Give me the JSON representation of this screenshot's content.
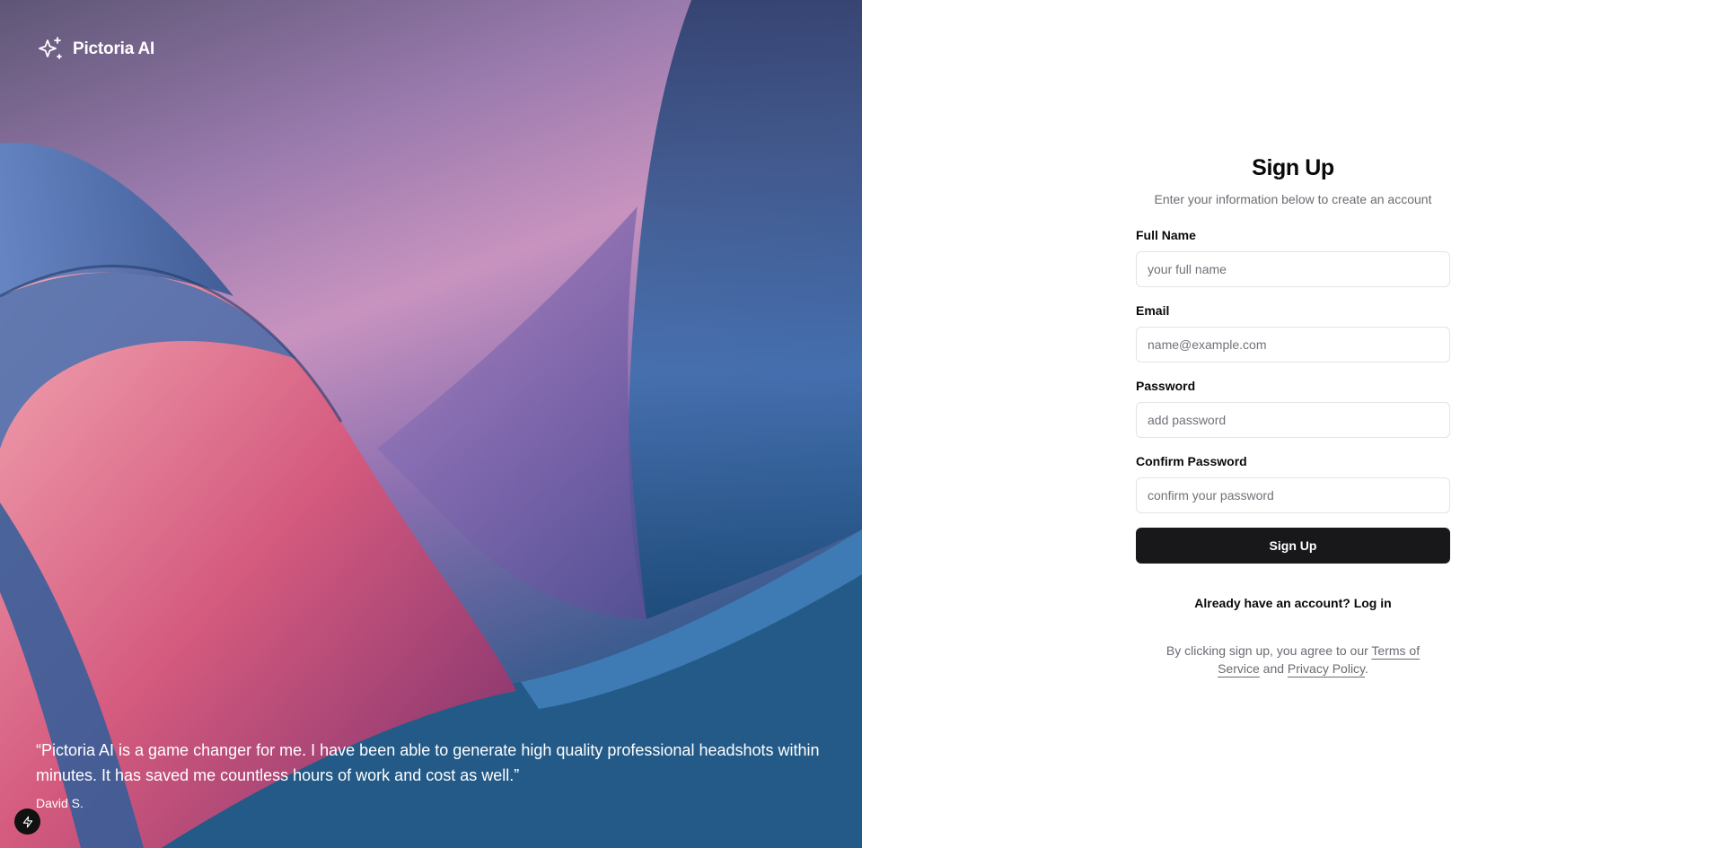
{
  "brand": {
    "name": "Pictoria AI",
    "icon": "sparkles-icon"
  },
  "hero": {
    "quote": "“Pictoria AI is a game changer for me. I have been able to generate high quality professional headshots within minutes. It has saved me countless hours of work and cost as well.”",
    "author": "David S.",
    "badge_icon": "bolt-icon"
  },
  "form": {
    "title": "Sign Up",
    "subtitle": "Enter your information below to create an account",
    "fields": [
      {
        "label": "Full Name",
        "placeholder": "your full name",
        "value": ""
      },
      {
        "label": "Email",
        "placeholder": "name@example.com",
        "value": ""
      },
      {
        "label": "Password",
        "placeholder": "add password",
        "value": ""
      },
      {
        "label": "Confirm Password",
        "placeholder": "confirm your password",
        "value": ""
      }
    ],
    "submit_label": "Sign Up",
    "login_prompt": "Already have an account?",
    "login_link": "Log in",
    "legal_prefix": "By clicking sign up, you agree to our",
    "terms_link": "Terms of Service",
    "legal_and": "and",
    "privacy_link": "Privacy Policy",
    "legal_suffix": "."
  },
  "colors": {
    "primary_button": "#18181b",
    "muted_text": "#6b6b73",
    "input_border": "#e4e4e7"
  }
}
